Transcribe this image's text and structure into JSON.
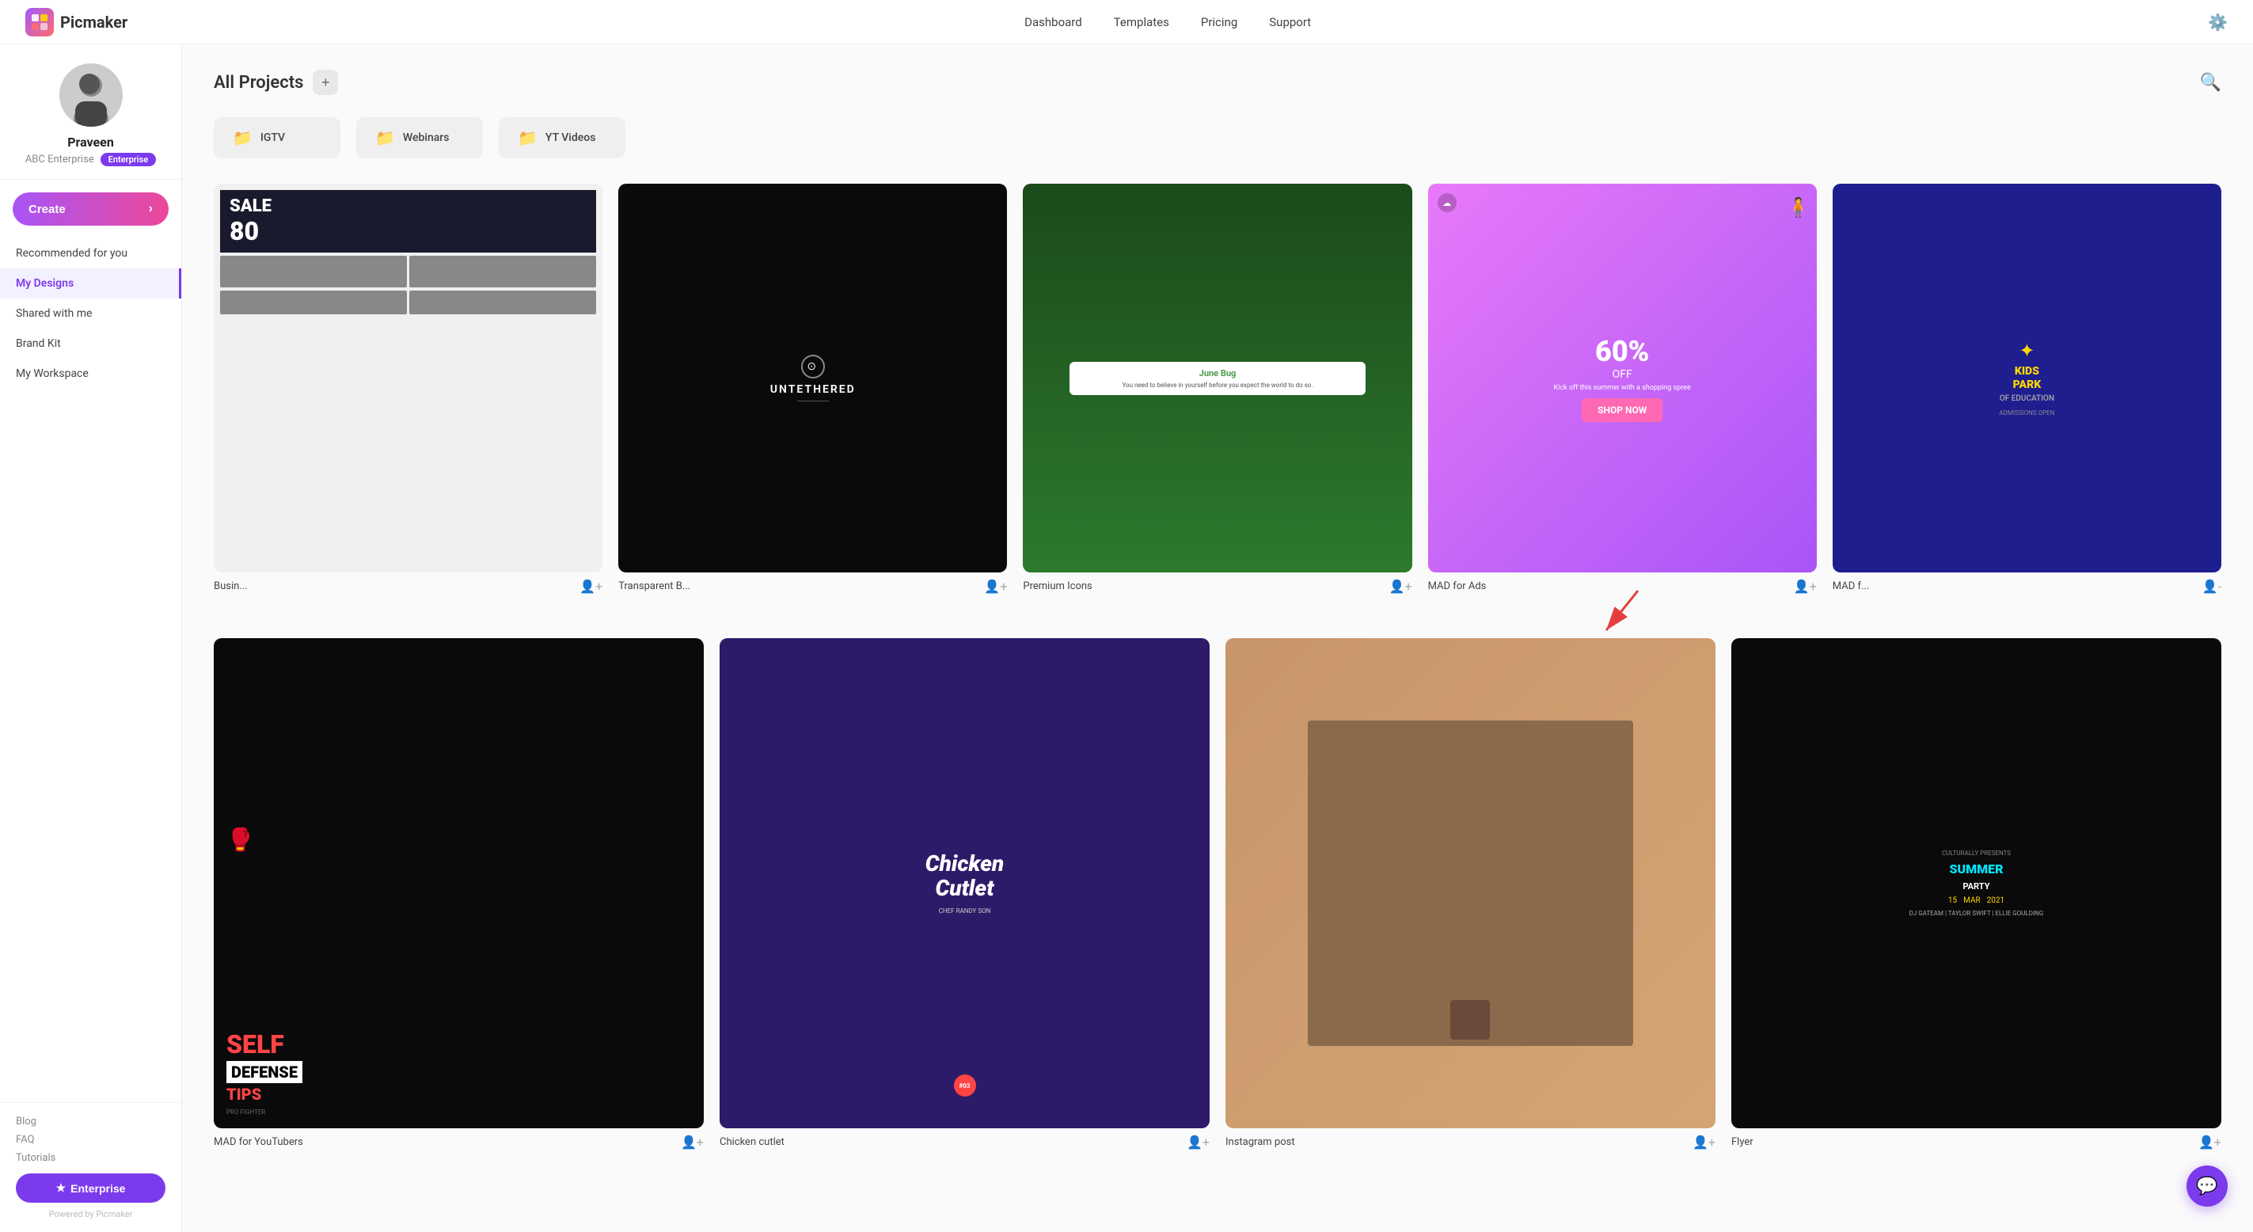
{
  "app": {
    "name": "Picmaker"
  },
  "nav": {
    "links": [
      "Dashboard",
      "Templates",
      "Pricing",
      "Support"
    ]
  },
  "sidebar": {
    "username": "Praveen",
    "company": "ABC Enterprise",
    "enterprise_badge": "Enterprise",
    "create_label": "Create",
    "nav_items": [
      {
        "id": "recommended",
        "label": "Recommended for you",
        "active": false
      },
      {
        "id": "my-designs",
        "label": "My Designs",
        "active": true
      },
      {
        "id": "shared",
        "label": "Shared with me",
        "active": false
      },
      {
        "id": "brand-kit",
        "label": "Brand Kit",
        "active": false
      },
      {
        "id": "workspace",
        "label": "My Workspace",
        "active": false
      }
    ],
    "footer_links": [
      "Blog",
      "FAQ",
      "Tutorials"
    ],
    "enterprise_btn": "Enterprise",
    "powered_by": "Powered by Picmaker"
  },
  "main": {
    "title": "All Projects",
    "folders": [
      {
        "label": "IGTV"
      },
      {
        "label": "Webinars"
      },
      {
        "label": "YT Videos"
      }
    ],
    "designs_row1": [
      {
        "label": "Busin...",
        "thumb": "business"
      },
      {
        "label": "Transparent B...",
        "thumb": "untethered"
      },
      {
        "label": "Premium Icons",
        "thumb": "premium"
      },
      {
        "label": "MAD for Ads",
        "thumb": "mad-ads"
      },
      {
        "label": "MAD f...",
        "thumb": "kids"
      }
    ],
    "designs_row2": [
      {
        "label": "MAD for YouTubers",
        "thumb": "self-defense"
      },
      {
        "label": "Chicken cutlet",
        "thumb": "chicken"
      },
      {
        "label": "Instagram post",
        "thumb": "instagram"
      },
      {
        "label": "Flyer",
        "thumb": "flyer"
      }
    ]
  },
  "chat_btn": "💬"
}
